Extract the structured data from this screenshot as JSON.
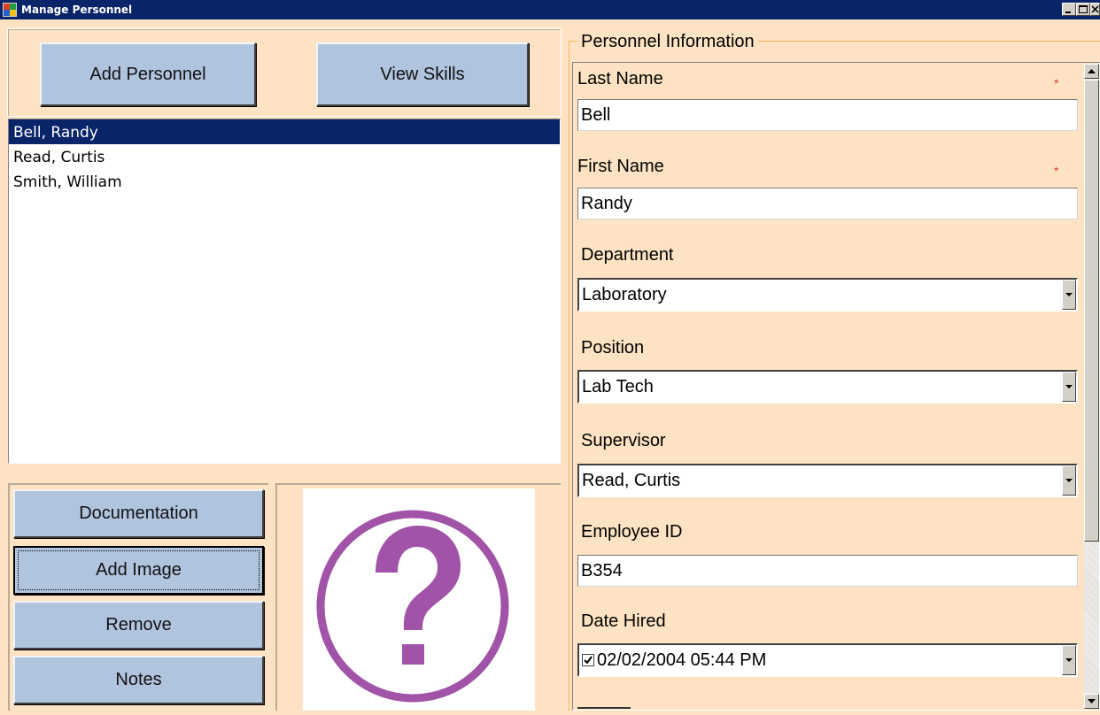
{
  "window": {
    "title": "Manage Personnel"
  },
  "top_buttons": {
    "add_personnel": "Add Personnel",
    "view_skills": "View Skills"
  },
  "personnel_list": {
    "items": [
      "Bell, Randy",
      "Read, Curtis",
      "Smith, William"
    ],
    "selected": "Bell, Randy"
  },
  "side_buttons": {
    "documentation": "Documentation",
    "add_image": "Add Image",
    "remove": "Remove",
    "notes": "Notes"
  },
  "image": {
    "placeholder_icon": "question-mark-icon",
    "color": "#a153a8"
  },
  "form": {
    "group_title": "Personnel Information",
    "required_marker": "*",
    "last_name": {
      "label": "Last Name",
      "value": "Bell"
    },
    "first_name": {
      "label": "First Name",
      "value": "Randy"
    },
    "department": {
      "label": "Department",
      "value": "Laboratory"
    },
    "position": {
      "label": "Position",
      "value": "Lab Tech"
    },
    "supervisor": {
      "label": "Supervisor",
      "value": "Read, Curtis"
    },
    "employee_id": {
      "label": "Employee ID",
      "value": "B354"
    },
    "date_hired": {
      "label": "Date Hired",
      "value": "02/02/2004 05:44 PM",
      "checked": true
    }
  },
  "colors": {
    "background": "#fde3c3",
    "button": "#b0c4de",
    "titlebar": "#0a246a",
    "selection": "#0a246a",
    "required": "#e23b3b"
  }
}
